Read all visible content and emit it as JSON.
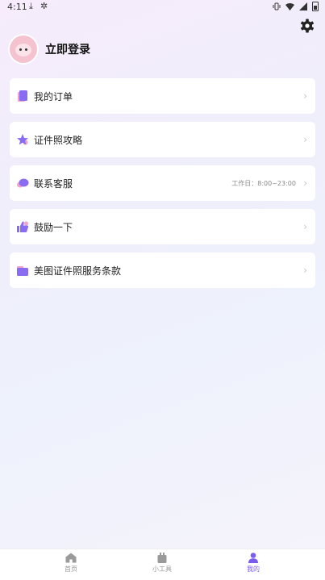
{
  "status": {
    "time": "4:11",
    "download_glyph": "⤓",
    "bug_glyph": "✲"
  },
  "header": {
    "login_label": "立即登录"
  },
  "menu": [
    {
      "label": "我的订单",
      "extra": "",
      "icon": "order-icon"
    },
    {
      "label": "证件照攻略",
      "extra": "",
      "icon": "star-icon"
    },
    {
      "label": "联系客服",
      "extra": "工作日：8:00~23:00",
      "icon": "chat-bubble-icon"
    },
    {
      "label": "鼓励一下",
      "extra": "",
      "icon": "thumbs-up-icon"
    },
    {
      "label": "美图证件照服务条款",
      "extra": "",
      "icon": "folder-icon"
    }
  ],
  "chevron": "›",
  "tabs": [
    {
      "label": "首页",
      "icon": "home-icon"
    },
    {
      "label": "小工具",
      "icon": "tools-icon"
    },
    {
      "label": "我的",
      "icon": "person-icon"
    }
  ],
  "colors": {
    "accent": "#7b5cf0",
    "icon_purple": "#8a6cf2",
    "icon_pink": "#f0a3c9"
  }
}
